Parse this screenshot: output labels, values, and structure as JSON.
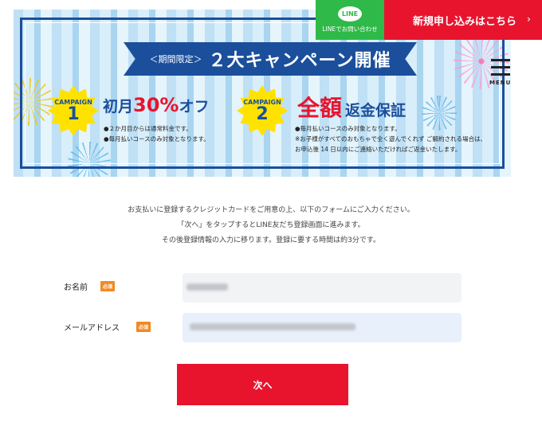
{
  "header": {
    "line_button": {
      "icon_text": "LINE",
      "label": "LINEでお問い合わせ"
    },
    "signup_button": {
      "label": "新規申し込みはこちら",
      "arrow": "›"
    },
    "menu_button": {
      "label": "MENU"
    }
  },
  "banner": {
    "title_prefix": "＜期間限定＞",
    "title": "２大キャンペーン開催",
    "campaigns": [
      {
        "badge_label": "CAMPAIGN",
        "badge_number": "1",
        "headline_a": "初月",
        "headline_highlight": "30%",
        "headline_b": "オフ",
        "notes": [
          "●２か月目からは通常料金です。",
          "●毎月払いコースのみ対象となります。"
        ]
      },
      {
        "badge_label": "CAMPAIGN",
        "badge_number": "2",
        "headline_highlight": "全額",
        "headline_b": "返金保証",
        "notes": [
          "●毎月払いコースのみ対象となります。",
          "※お子様がすべてのおもちゃで全く遊んでくれず ご解約される場合は、",
          "お申込後 14 日以内にご連絡いただければご返金いたします。"
        ]
      }
    ]
  },
  "intro": {
    "lines": [
      "お支払いに登録するクレジットカードをご用意の上、以下のフォームにご入力ください。",
      "「次へ」をタップするとLINE友だち登録画面に進みます。",
      "その後登録情報の入力に移ります。登録に要する時間は約3分です。"
    ]
  },
  "form": {
    "name": {
      "label": "お名前",
      "required": "必須",
      "value": ""
    },
    "email": {
      "label": "メールアドレス",
      "required": "必須",
      "value": ""
    },
    "submit_label": "次へ"
  },
  "colors": {
    "brand_red": "#e8142e",
    "line_green": "#2fb949",
    "navy": "#1b4f9c",
    "required_orange": "#f08a24"
  }
}
